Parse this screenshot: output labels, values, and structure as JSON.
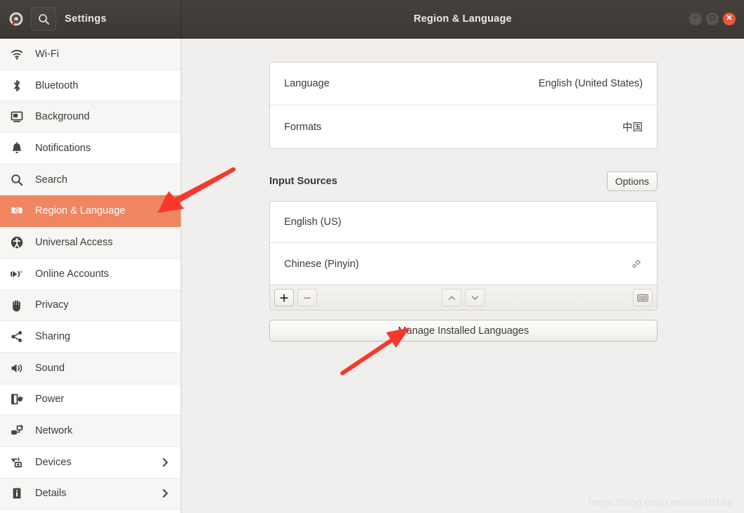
{
  "window": {
    "app_title": "Settings",
    "page_title": "Region & Language",
    "app_icon": "settings-gauge-icon",
    "search_icon": "search-icon",
    "controls": {
      "minimize": "minimize-icon",
      "maximize": "maximize-icon",
      "close": "close-icon"
    },
    "colors": {
      "titlebar": "#403b37",
      "close_button": "#e8593a",
      "selection": "#ef8661",
      "content_bg": "#f0efee"
    }
  },
  "sidebar": {
    "items": [
      {
        "label": "Wi-Fi",
        "icon": "wifi-icon",
        "selected": false,
        "has_chevron": false
      },
      {
        "label": "Bluetooth",
        "icon": "bluetooth-icon",
        "selected": false,
        "has_chevron": false
      },
      {
        "label": "Background",
        "icon": "monitor-icon",
        "selected": false,
        "has_chevron": false
      },
      {
        "label": "Notifications",
        "icon": "bell-icon",
        "selected": false,
        "has_chevron": false
      },
      {
        "label": "Search",
        "icon": "search-icon",
        "selected": false,
        "has_chevron": false
      },
      {
        "label": "Region & Language",
        "icon": "language-flag-icon",
        "selected": true,
        "has_chevron": false
      },
      {
        "label": "Universal Access",
        "icon": "accessibility-icon",
        "selected": false,
        "has_chevron": false
      },
      {
        "label": "Online Accounts",
        "icon": "online-accounts-icon",
        "selected": false,
        "has_chevron": false
      },
      {
        "label": "Privacy",
        "icon": "hand-icon",
        "selected": false,
        "has_chevron": false
      },
      {
        "label": "Sharing",
        "icon": "share-icon",
        "selected": false,
        "has_chevron": false
      },
      {
        "label": "Sound",
        "icon": "speaker-icon",
        "selected": false,
        "has_chevron": false
      },
      {
        "label": "Power",
        "icon": "power-plug-icon",
        "selected": false,
        "has_chevron": false
      },
      {
        "label": "Network",
        "icon": "network-icon",
        "selected": false,
        "has_chevron": false
      },
      {
        "label": "Devices",
        "icon": "devices-icon",
        "selected": false,
        "has_chevron": true
      },
      {
        "label": "Details",
        "icon": "info-icon",
        "selected": false,
        "has_chevron": true
      }
    ]
  },
  "main": {
    "settings_rows": [
      {
        "label": "Language",
        "value": "English (United States)"
      },
      {
        "label": "Formats",
        "value": "中国"
      }
    ],
    "input_sources": {
      "title": "Input Sources",
      "options_label": "Options",
      "sources": [
        {
          "label": "English (US)",
          "has_gear": false,
          "gear_icon": ""
        },
        {
          "label": "Chinese (Pinyin)",
          "has_gear": true,
          "gear_icon": "preferences-gear-icon"
        }
      ],
      "toolbar": {
        "add": "+",
        "remove": "−",
        "move_up": "chevron-up-icon",
        "move_down": "chevron-down-icon",
        "keyboard": "keyboard-icon"
      }
    },
    "manage_button": "Manage Installed Languages"
  },
  "annotations": {
    "arrows": [
      {
        "name": "arrow-to-region-language",
        "target": "Region & Language"
      },
      {
        "name": "arrow-to-manage-languages",
        "target": "Manage Installed Languages"
      }
    ],
    "arrow_color": "#f9382c"
  },
  "watermark": {
    "text": "https://blog.csdn.net/wu10188"
  }
}
